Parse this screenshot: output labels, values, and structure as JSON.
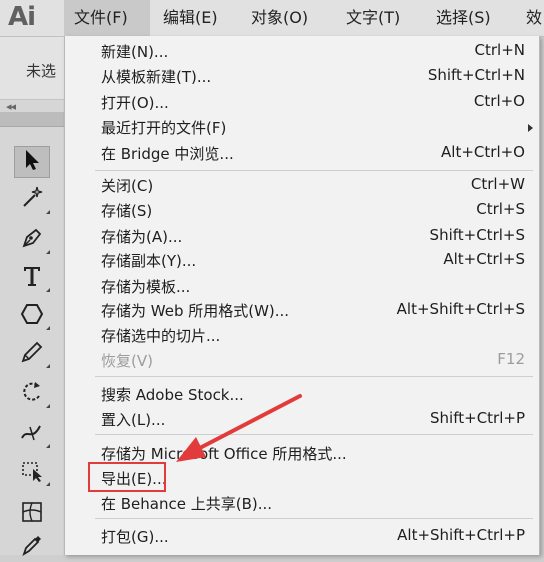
{
  "app": {
    "logo_text": "Ai"
  },
  "menubar": {
    "items": [
      {
        "label": "文件(F)"
      },
      {
        "label": "编辑(E)"
      },
      {
        "label": "对象(O)"
      },
      {
        "label": "文字(T)"
      },
      {
        "label": "选择(S)"
      },
      {
        "label": "效"
      }
    ]
  },
  "control_panel": {
    "status_label": "未选"
  },
  "file_menu": {
    "items": [
      {
        "label": "新建(N)...",
        "shortcut": "Ctrl+N"
      },
      {
        "label": "从模板新建(T)...",
        "shortcut": "Shift+Ctrl+N"
      },
      {
        "label": "打开(O)...",
        "shortcut": "Ctrl+O"
      },
      {
        "label": "最近打开的文件(F)",
        "shortcut": ""
      },
      {
        "label": "在 Bridge 中浏览...",
        "shortcut": "Alt+Ctrl+O"
      },
      {
        "label": "关闭(C)",
        "shortcut": "Ctrl+W"
      },
      {
        "label": "存储(S)",
        "shortcut": "Ctrl+S"
      },
      {
        "label": "存储为(A)...",
        "shortcut": "Shift+Ctrl+S"
      },
      {
        "label": "存储副本(Y)...",
        "shortcut": "Alt+Ctrl+S"
      },
      {
        "label": "存储为模板...",
        "shortcut": ""
      },
      {
        "label": "存储为 Web 所用格式(W)...",
        "shortcut": "Alt+Shift+Ctrl+S"
      },
      {
        "label": "存储选中的切片...",
        "shortcut": ""
      },
      {
        "label": "恢复(V)",
        "shortcut": "F12"
      },
      {
        "label": "搜索 Adobe Stock...",
        "shortcut": ""
      },
      {
        "label": "置入(L)...",
        "shortcut": "Shift+Ctrl+P"
      },
      {
        "label": "存储为 Microsoft Office 所用格式...",
        "shortcut": ""
      },
      {
        "label": "导出(E)...",
        "shortcut": ""
      },
      {
        "label": "在 Behance 上共享(B)...",
        "shortcut": ""
      },
      {
        "label": "打包(G)...",
        "shortcut": "Alt+Shift+Ctrl+P"
      }
    ]
  },
  "colors": {
    "highlight": "#e23b3b",
    "menu_background": "#f2f2f2",
    "menubar_background": "#e1e1e1"
  },
  "tools": [
    {
      "icon": "selection-arrow-icon"
    },
    {
      "icon": "magic-wand-icon"
    },
    {
      "icon": "pen-icon"
    },
    {
      "icon": "type-icon"
    },
    {
      "icon": "shape-icon"
    },
    {
      "icon": "pencil-icon"
    },
    {
      "icon": "rotate-icon"
    },
    {
      "icon": "width-icon"
    },
    {
      "icon": "free-transform-icon"
    },
    {
      "icon": "mesh-icon"
    },
    {
      "icon": "eyedropper-icon"
    }
  ]
}
